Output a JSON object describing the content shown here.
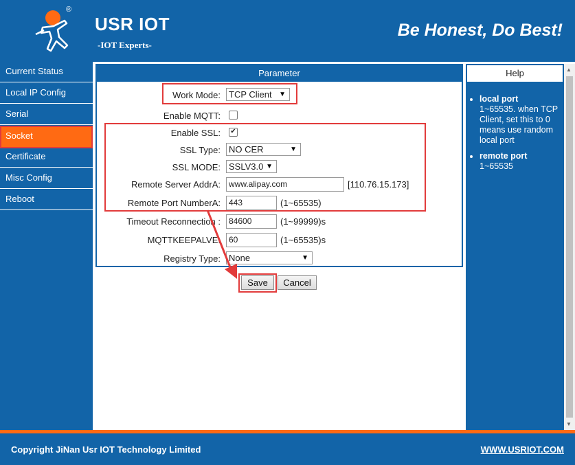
{
  "header": {
    "brand": "USR IOT",
    "subbrand": "-IOT Experts-",
    "slogan": "Be Honest, Do Best!",
    "registered_mark": "®"
  },
  "sidebar": {
    "items": [
      {
        "label": "Current Status",
        "active": false
      },
      {
        "label": "Local IP Config",
        "active": false
      },
      {
        "label": "Serial",
        "active": false
      },
      {
        "label": "Socket",
        "active": true
      },
      {
        "label": "Certificate",
        "active": false
      },
      {
        "label": "Misc Config",
        "active": false
      },
      {
        "label": "Reboot",
        "active": false
      }
    ]
  },
  "parameter": {
    "title": "Parameter",
    "work_mode": {
      "label": "Work Mode:",
      "value": "TCP Client"
    },
    "enable_mqtt": {
      "label": "Enable MQTT:",
      "checked": false
    },
    "enable_ssl": {
      "label": "Enable SSL:",
      "checked": true,
      "mark": "✔"
    },
    "ssl_type": {
      "label": "SSL Type:",
      "value": "NO CER"
    },
    "ssl_mode": {
      "label": "SSL MODE:",
      "value": "SSLV3.0"
    },
    "remote_server": {
      "label": "Remote Server AddrA:",
      "value": "www.alipay.com",
      "hint": "[110.76.15.173]"
    },
    "remote_port": {
      "label": "Remote Port NumberA:",
      "value": "443",
      "hint": "(1~65535)"
    },
    "timeout": {
      "label": "Timeout Reconnection :",
      "value": "84600",
      "hint": "(1~99999)s"
    },
    "mqtt_keepalive": {
      "label": "MQTTKEEPALVE:",
      "value": "60",
      "hint": "(1~65535)s"
    },
    "registry_type": {
      "label": "Registry Type:",
      "value": "None"
    }
  },
  "buttons": {
    "save": "Save",
    "cancel": "Cancel"
  },
  "help": {
    "title": "Help",
    "items": [
      {
        "term": "local port",
        "desc": "1~65535. when TCP Client, set this to 0 means use random local port"
      },
      {
        "term": "remote port",
        "desc": "1~65535"
      }
    ]
  },
  "footer": {
    "copyright": "Copyright JiNan Usr IOT Technology Limited",
    "link": "WWW.USRIOT.COM"
  },
  "colors": {
    "primary": "#1264a8",
    "accent": "#ff6a13",
    "highlight": "#e23b3b"
  },
  "icons": {
    "logo": "running-man-logo-icon",
    "dropdown": "dropdown-arrow-icon",
    "checkbox_mark": "checkmark-icon"
  }
}
